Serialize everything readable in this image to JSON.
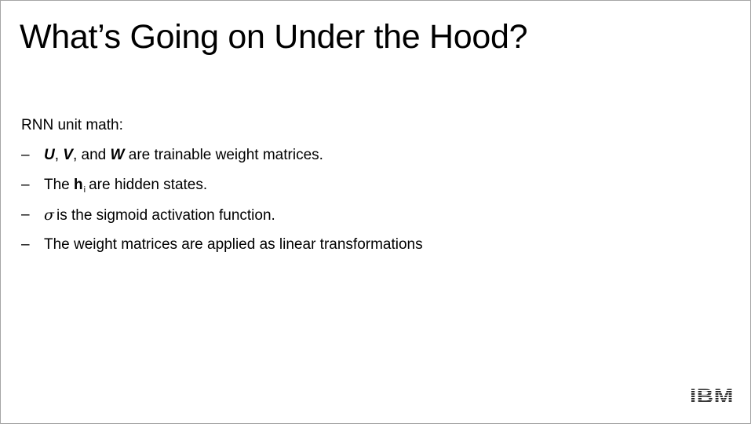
{
  "slide": {
    "title": "What’s Going on Under the Hood?",
    "intro": "RNN unit math:",
    "bullet_marker": "–",
    "bullets": {
      "b1": {
        "u": "U",
        "comma1": ", ",
        "v": "V",
        "comma_and": ", and ",
        "w": "W",
        "rest": " are trainable weight matrices."
      },
      "b2": {
        "pre": "The ",
        "h": "h",
        "sub": "i",
        "rest": "are hidden states."
      },
      "b3": {
        "sigma": "σ",
        "rest": "is the sigmoid activation function."
      },
      "b4": {
        "text": "The weight matrices are applied as linear transformations"
      }
    },
    "logo": {
      "text": "IBM",
      "icon": "ibm-logo-icon",
      "color": "#1f1f1f"
    }
  }
}
